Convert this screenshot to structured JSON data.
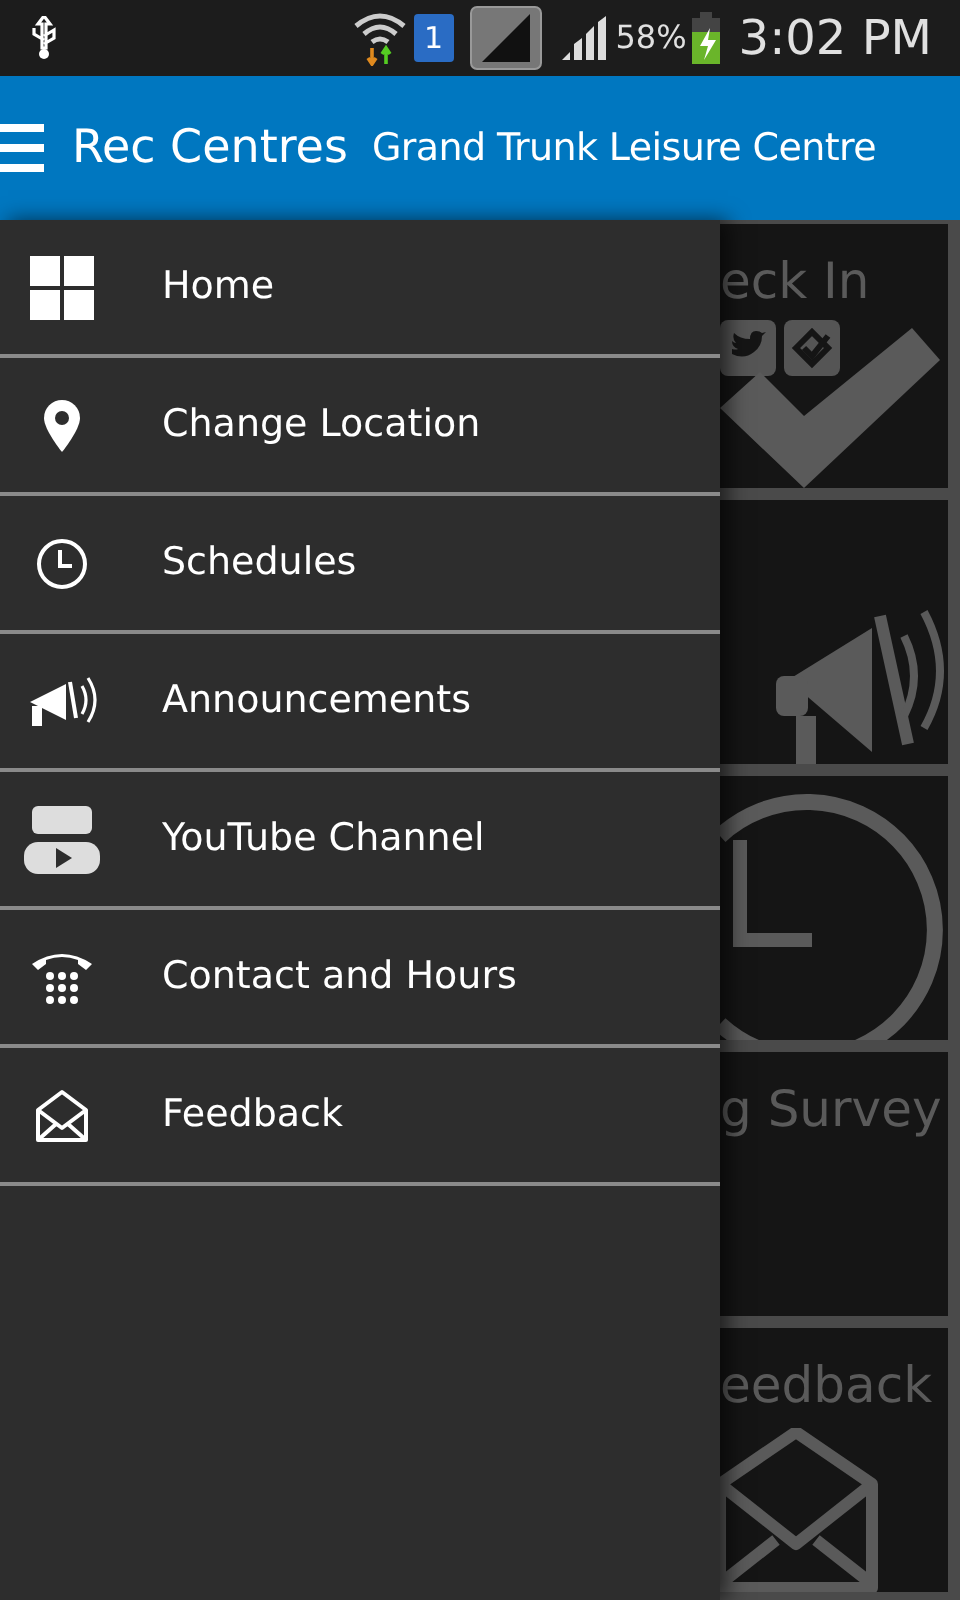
{
  "status_bar": {
    "battery": "58%",
    "time": "3:02 PM",
    "sim": "1"
  },
  "header": {
    "app_title": "Rec Centres",
    "location": "Grand Trunk Leisure Centre"
  },
  "drawer": {
    "items": [
      {
        "kind": "grid",
        "label": "Home"
      },
      {
        "kind": "pin",
        "label": "Change Location"
      },
      {
        "kind": "clock",
        "label": "Schedules"
      },
      {
        "kind": "megaphone",
        "label": "Announcements"
      },
      {
        "kind": "video",
        "label": "YouTube Channel"
      },
      {
        "kind": "phone",
        "label": "Contact and Hours"
      },
      {
        "kind": "envelope",
        "label": "Feedback"
      }
    ]
  },
  "tiles": [
    {
      "kind": "checkin",
      "label": "eck In"
    },
    {
      "kind": "megaphone"
    },
    {
      "kind": "clock"
    },
    {
      "kind": "survey",
      "label": "g Survey"
    },
    {
      "kind": "envelope",
      "label": "eedback"
    }
  ]
}
